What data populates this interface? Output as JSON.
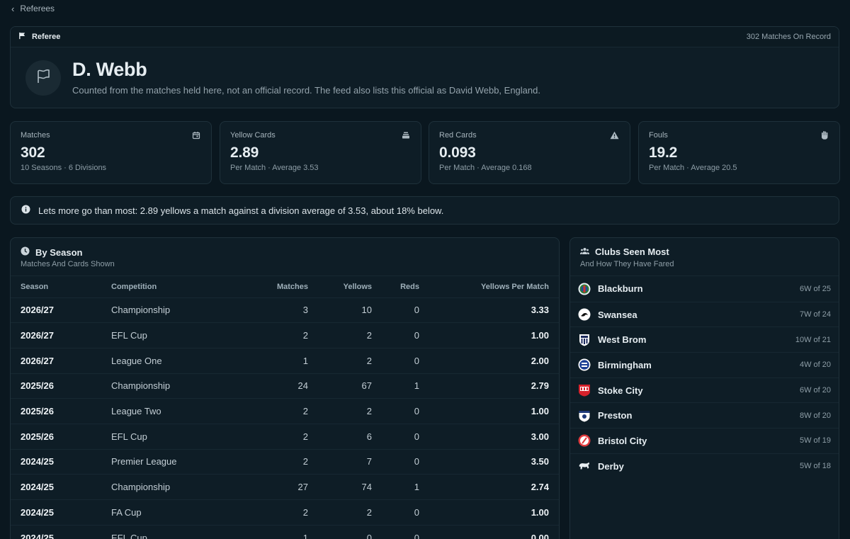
{
  "nav": {
    "back_label": "Referees"
  },
  "referee": {
    "section_label": "Referee",
    "record_count": "302 Matches On Record",
    "name": "D. Webb",
    "note": "Counted from the matches held here, not an official record. The feed also lists this official as David Webb, England."
  },
  "stats": [
    {
      "label": "Matches",
      "value": "302",
      "sub": "10 Seasons · 6 Divisions",
      "icon": "calendar-icon"
    },
    {
      "label": "Yellow Cards",
      "value": "2.89",
      "sub": "Per Match · Average 3.53",
      "icon": "card-stack-icon"
    },
    {
      "label": "Red Cards",
      "value": "0.093",
      "sub": "Per Match · Average 0.168",
      "icon": "warning-icon"
    },
    {
      "label": "Fouls",
      "value": "19.2",
      "sub": "Per Match · Average 20.5",
      "icon": "hand-icon"
    }
  ],
  "banner": {
    "text": "Lets more go than most: 2.89 yellows a match against a division average of 3.53, about 18% below."
  },
  "by_season": {
    "title": "By Season",
    "subtitle": "Matches And Cards Shown",
    "columns": [
      "Season",
      "Competition",
      "Matches",
      "Yellows",
      "Reds",
      "Yellows Per Match"
    ],
    "rows": [
      {
        "season": "2026/27",
        "competition": "Championship",
        "matches": "3",
        "yellows": "10",
        "reds": "0",
        "ypm": "3.33"
      },
      {
        "season": "2026/27",
        "competition": "EFL Cup",
        "matches": "2",
        "yellows": "2",
        "reds": "0",
        "ypm": "1.00"
      },
      {
        "season": "2026/27",
        "competition": "League One",
        "matches": "1",
        "yellows": "2",
        "reds": "0",
        "ypm": "2.00"
      },
      {
        "season": "2025/26",
        "competition": "Championship",
        "matches": "24",
        "yellows": "67",
        "reds": "1",
        "ypm": "2.79"
      },
      {
        "season": "2025/26",
        "competition": "League Two",
        "matches": "2",
        "yellows": "2",
        "reds": "0",
        "ypm": "1.00"
      },
      {
        "season": "2025/26",
        "competition": "EFL Cup",
        "matches": "2",
        "yellows": "6",
        "reds": "0",
        "ypm": "3.00"
      },
      {
        "season": "2024/25",
        "competition": "Premier League",
        "matches": "2",
        "yellows": "7",
        "reds": "0",
        "ypm": "3.50"
      },
      {
        "season": "2024/25",
        "competition": "Championship",
        "matches": "27",
        "yellows": "74",
        "reds": "1",
        "ypm": "2.74"
      },
      {
        "season": "2024/25",
        "competition": "FA Cup",
        "matches": "2",
        "yellows": "2",
        "reds": "0",
        "ypm": "1.00"
      },
      {
        "season": "2024/25",
        "competition": "EFL Cup",
        "matches": "1",
        "yellows": "0",
        "reds": "0",
        "ypm": "0.00"
      }
    ]
  },
  "clubs": {
    "title": "Clubs Seen Most",
    "subtitle": "And How They Have Fared",
    "items": [
      {
        "name": "Blackburn",
        "record": "6W of 25",
        "crest": "blackburn-crest-icon"
      },
      {
        "name": "Swansea",
        "record": "7W of 24",
        "crest": "swansea-crest-icon"
      },
      {
        "name": "West Brom",
        "record": "10W of 21",
        "crest": "west-brom-crest-icon"
      },
      {
        "name": "Birmingham",
        "record": "4W of 20",
        "crest": "birmingham-crest-icon"
      },
      {
        "name": "Stoke City",
        "record": "6W of 20",
        "crest": "stoke-city-crest-icon"
      },
      {
        "name": "Preston",
        "record": "8W of 20",
        "crest": "preston-crest-icon"
      },
      {
        "name": "Bristol City",
        "record": "5W of 19",
        "crest": "bristol-city-crest-icon"
      },
      {
        "name": "Derby",
        "record": "5W of 18",
        "crest": "derby-crest-icon"
      }
    ]
  },
  "colors": {
    "background": "#0a171f",
    "card": "#0e1d26",
    "border": "#1f313b",
    "red": "#e8455b"
  }
}
